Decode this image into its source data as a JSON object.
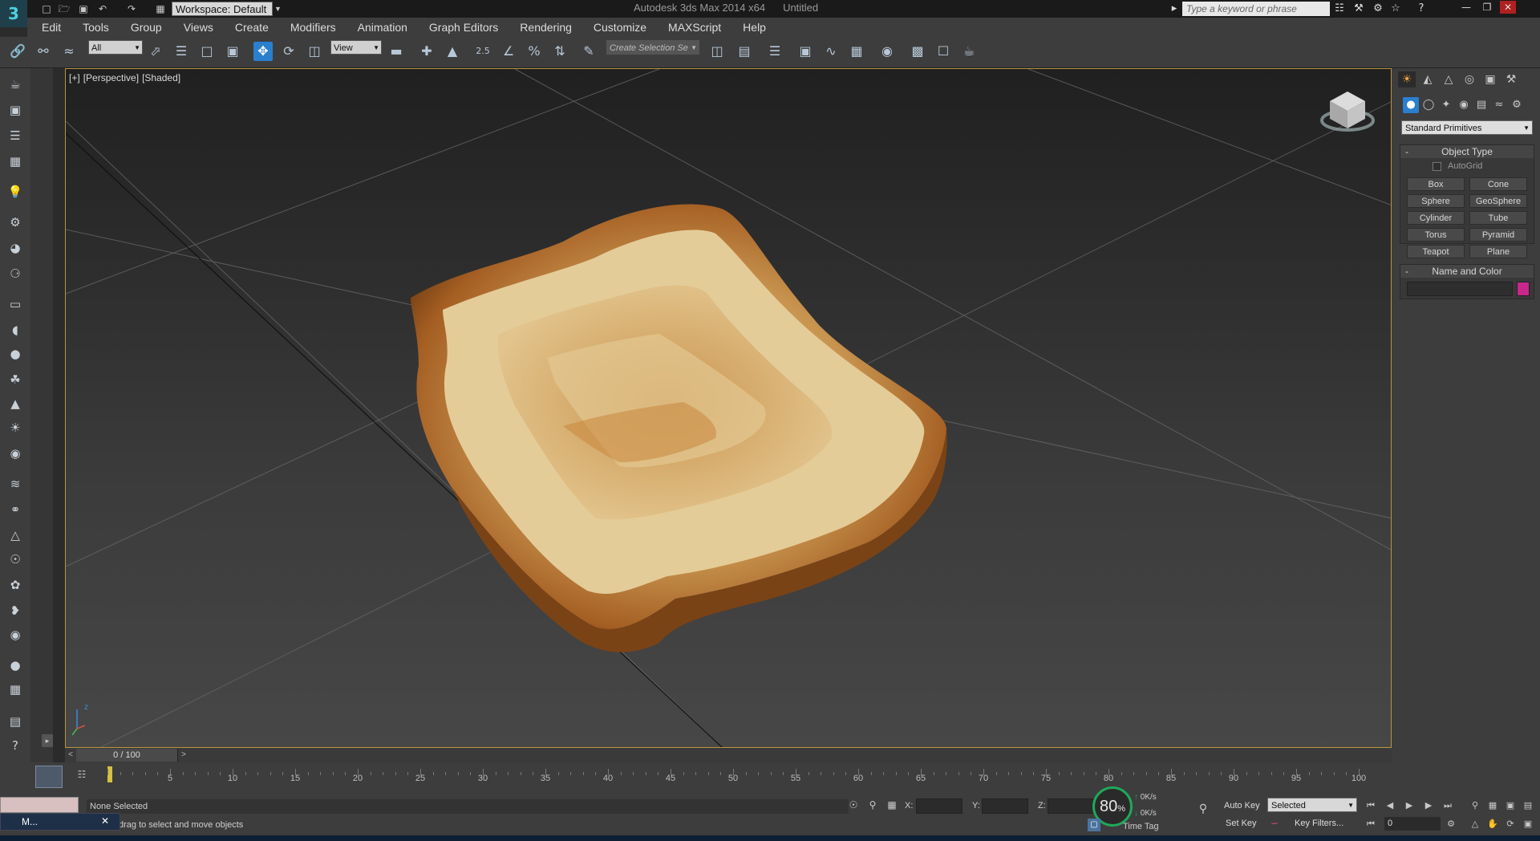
{
  "titlebar": {
    "logo": "3",
    "workspace_label": "Workspace: Default",
    "app_name": "Autodesk 3ds Max  2014 x64",
    "document": "Untitled",
    "search_placeholder": "Type a keyword or phrase"
  },
  "menu": [
    "Edit",
    "Tools",
    "Group",
    "Views",
    "Create",
    "Modifiers",
    "Animation",
    "Graph Editors",
    "Rendering",
    "Customize",
    "MAXScript",
    "Help"
  ],
  "toolbar": {
    "selection_filter": "All",
    "reference_coord": "View",
    "snap_value": "2.5",
    "create_selection_set": "Create Selection Se"
  },
  "viewport": {
    "label_plus": "[+]",
    "label_view": "[Perspective]",
    "label_shading": "[Shaded]",
    "axis_z": "z"
  },
  "command_panel": {
    "category": "Standard Primitives",
    "object_type_title": "Object Type",
    "autogrid_label": "AutoGrid",
    "primitives": [
      "Box",
      "Cone",
      "Sphere",
      "GeoSphere",
      "Cylinder",
      "Tube",
      "Torus",
      "Pyramid",
      "Teapot",
      "Plane"
    ],
    "name_color_title": "Name and Color",
    "object_color": "#c8288a"
  },
  "timeline": {
    "frame_display": "0 / 100",
    "ticks": [
      "5",
      "10",
      "15",
      "20",
      "25",
      "30",
      "35",
      "40",
      "45",
      "50",
      "55",
      "60",
      "65",
      "70",
      "75",
      "80",
      "85",
      "90",
      "95",
      "100"
    ]
  },
  "status": {
    "selection": "None Selected",
    "prompt": "drag to select and move objects",
    "x_label": "X:",
    "y_label": "Y:",
    "z_label": "Z:",
    "gauge_value": "80",
    "gauge_unit": "%",
    "speed_up": "0",
    "speed_down": "0",
    "speed_unit": "K/s",
    "time_tag": "Time Tag",
    "auto_key": "Auto Key",
    "set_key": "Set Key",
    "key_mode": "Selected",
    "key_filters": "Key Filters...",
    "current_frame": "0"
  },
  "taskbar": {
    "popup_label": "M..."
  }
}
